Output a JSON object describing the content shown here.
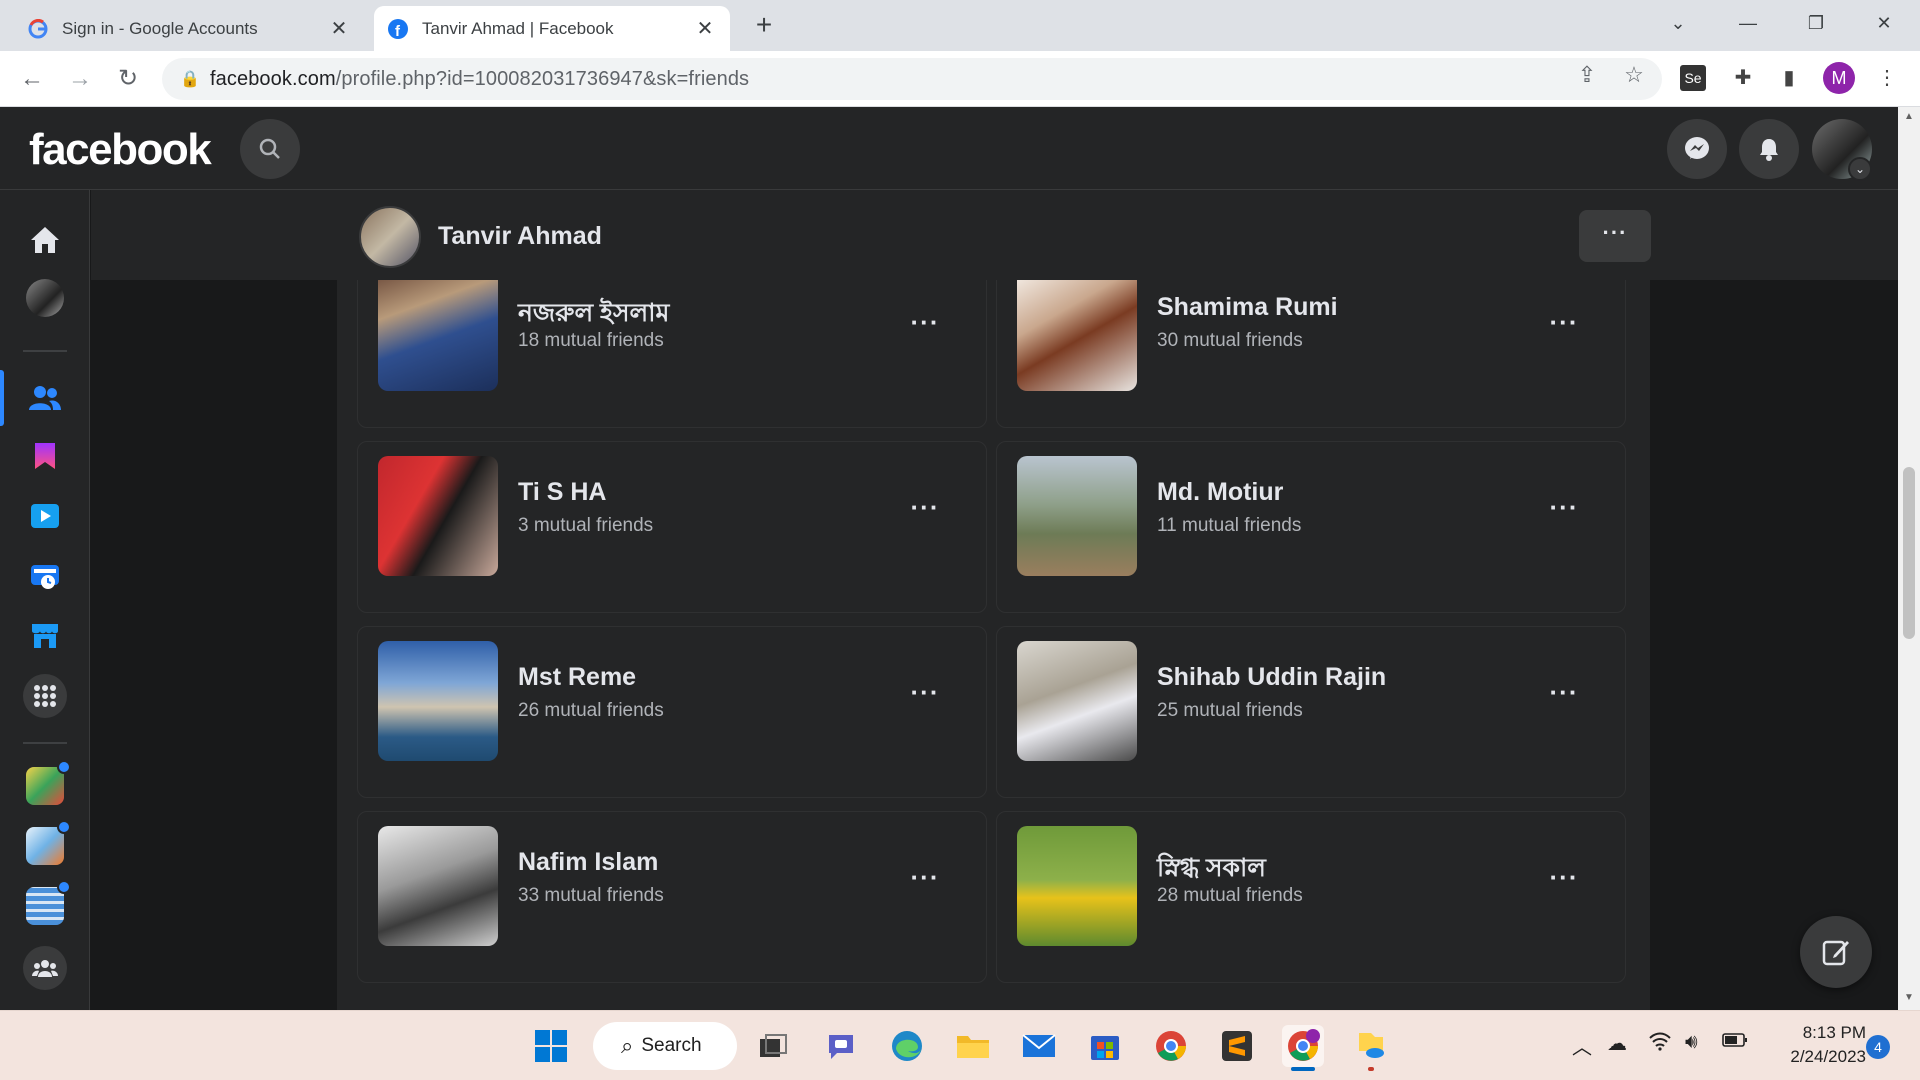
{
  "browser": {
    "tabs": [
      {
        "title": "Sign in - Google Accounts",
        "active": false
      },
      {
        "title": "Tanvir Ahmad | Facebook",
        "active": true
      }
    ],
    "url_host": "facebook.com",
    "url_path": "/profile.php?id=100082031736947&sk=friends",
    "profile_initial": "M",
    "extension_label": "Se"
  },
  "facebook": {
    "logo": "facebook",
    "profile_name": "Tanvir Ahmad",
    "more_label": "···",
    "friends": [
      {
        "name": "নজরুল ইসলাম",
        "mutual": "18 mutual friends",
        "photo": "linear-gradient(160deg,#6b4a3a 0%,#b89a7a 30%,#2f4f8f 55%,#1c2f5a 100%)"
      },
      {
        "name": "Shamima Rumi",
        "mutual": "30 mutual friends",
        "photo": "linear-gradient(150deg,#f6f0ea 0%,#c9a78d 35%,#7a3b22 55%,#e8e4e0 100%)"
      },
      {
        "name": "Ti S HA",
        "mutual": "3 mutual friends",
        "photo": "linear-gradient(120deg,#c1272d 0%,#d33 35%,#1a1a1a 55%,#c8a89a 100%)"
      },
      {
        "name": "Md. Motiur",
        "mutual": "11 mutual friends",
        "photo": "linear-gradient(180deg,#b9c4cf 0%,#8fa08a 40%,#6d7b56 65%,#9a7e5e 100%)"
      },
      {
        "name": "Mst Reme",
        "mutual": "26 mutual friends",
        "photo": "linear-gradient(180deg,#2f5fa8 0%,#7fa6d6 35%,#cfc4b0 55%,#2b5a86 80%,#1f4a70 100%)"
      },
      {
        "name": "Shihab Uddin Rajin",
        "mutual": "25 mutual friends",
        "photo": "linear-gradient(160deg,#d9d6cf 0%,#a9a294 40%,#e9e9ee 60%,#4a4a4a 100%)"
      },
      {
        "name": "Nafim Islam",
        "mutual": "33 mutual friends",
        "photo": "linear-gradient(160deg,#e8e8e8 0%,#9a9a9a 40%,#3b3b3b 65%,#cfcfcf 100%)"
      },
      {
        "name": "স্নিগ্ধ সকাল",
        "mutual": "28 mutual friends",
        "photo": "linear-gradient(180deg,#6f9a3a 0%,#8db04a 45%,#e7c21a 60%,#5e8a2e 100%)"
      }
    ],
    "card_menu_label": "···"
  },
  "icons": {
    "home": "home-icon",
    "friends": "friends-icon",
    "saved": "saved-icon",
    "watch": "watch-icon",
    "memories": "memories-icon",
    "marketplace": "marketplace-icon",
    "menu": "grid-menu-icon",
    "groups": "groups-icon"
  },
  "taskbar": {
    "search_label": "Search",
    "time": "8:13 PM",
    "date": "2/24/2023",
    "notifications": "4"
  },
  "colors": {
    "fb_blue": "#2d88ff",
    "surface": "#242526",
    "background": "#18191a",
    "text_primary": "#e4e6eb",
    "text_secondary": "#b0b3b8"
  }
}
